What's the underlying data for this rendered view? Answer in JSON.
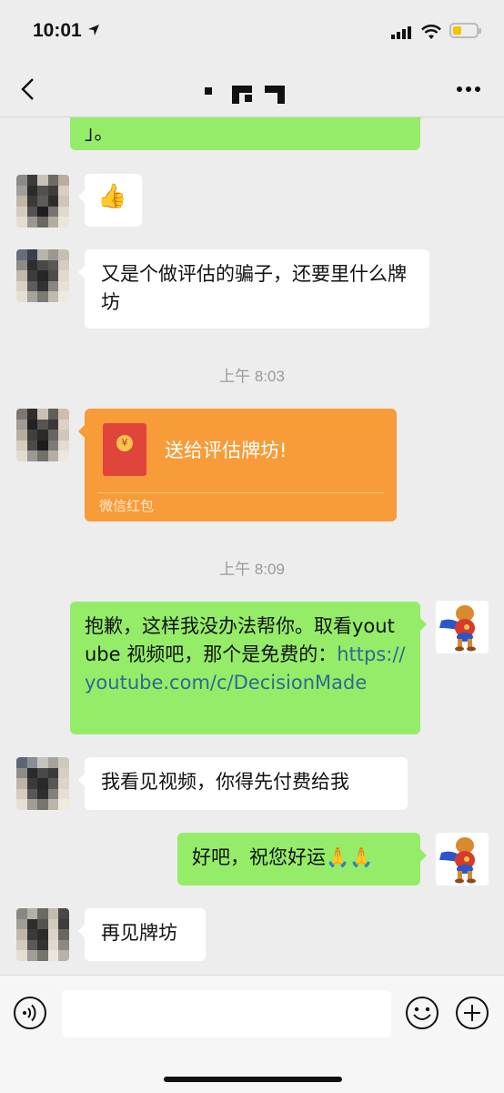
{
  "status_bar": {
    "time": "10:01"
  },
  "header": {
    "title": "",
    "back_icon": "chevron-left-icon",
    "more_icon": "ellipsis-icon"
  },
  "messages": {
    "m0_partial": "」。",
    "m1_emoji": "👍",
    "m2_text": "又是个做评估的骗子，还要里什么牌坊",
    "ts1": "上午 8:03",
    "red_packet": {
      "title": "送给评估牌坊!",
      "label": "微信红包",
      "coin": "¥"
    },
    "ts2": "上午 8:09",
    "m3_text": "抱歉，这样我没办法帮你。取看youtube 视频吧，那个是免费的：",
    "m3_link": "https://youtube.com/c/DecisionMade",
    "m4_text": "我看见视频，你得先付费给我",
    "m5_text": "好吧，祝您好运🙏🙏",
    "m6_text": "再见牌坊"
  },
  "input_bar": {
    "placeholder": "",
    "icons": [
      "voice-icon",
      "emoji-icon",
      "plus-icon"
    ]
  },
  "colors": {
    "out_bubble": "#95ec69",
    "in_bubble": "#ffffff",
    "red_packet": "#f79c38",
    "link": "#2e6a92"
  }
}
